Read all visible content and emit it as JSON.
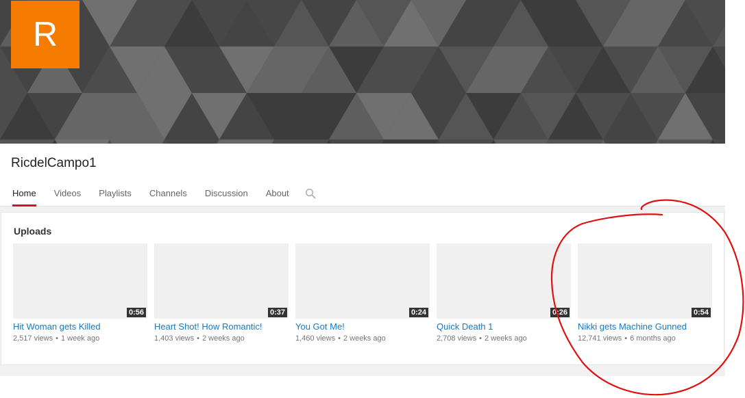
{
  "channel": {
    "avatar_letter": "R",
    "name": "RicdelCampo1"
  },
  "tabs": [
    {
      "label": "Home",
      "active": true
    },
    {
      "label": "Videos",
      "active": false
    },
    {
      "label": "Playlists",
      "active": false
    },
    {
      "label": "Channels",
      "active": false
    },
    {
      "label": "Discussion",
      "active": false
    },
    {
      "label": "About",
      "active": false
    }
  ],
  "search_icon": "search-icon",
  "uploads": {
    "title": "Uploads",
    "videos": [
      {
        "title": "Hit Woman gets Killed",
        "duration": "0:56",
        "views": "2,517 views",
        "age": "1 week ago"
      },
      {
        "title": "Heart Shot! How Romantic!",
        "duration": "0:37",
        "views": "1,403 views",
        "age": "2 weeks ago"
      },
      {
        "title": "You Got Me!",
        "duration": "0:24",
        "views": "1,460 views",
        "age": "2 weeks ago"
      },
      {
        "title": "Quick Death 1",
        "duration": "0:26",
        "views": "2,708 views",
        "age": "2 weeks ago"
      },
      {
        "title": "Nikki gets Machine Gunned",
        "duration": "0:54",
        "views": "12,741 views",
        "age": "6 months ago"
      }
    ],
    "meta_separator": "•"
  },
  "colors": {
    "avatar": "#f57c00",
    "active_tab_underline": "#cc181e",
    "link": "#167ac6",
    "annotation": "#e01010"
  }
}
